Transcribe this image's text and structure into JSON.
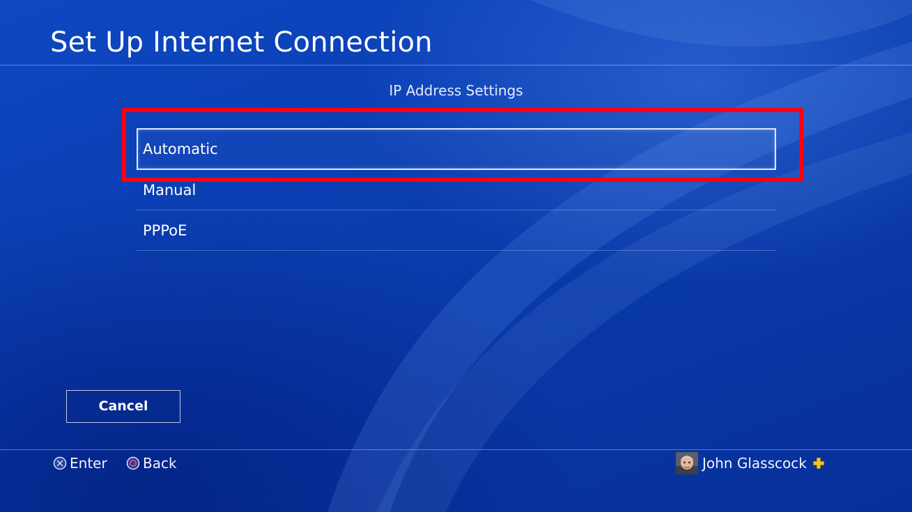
{
  "header": {
    "title": "Set Up Internet Connection"
  },
  "dialog": {
    "subtitle": "IP Address Settings",
    "options": [
      {
        "label": "Automatic",
        "selected": true
      },
      {
        "label": "Manual",
        "selected": false
      },
      {
        "label": "PPPoE",
        "selected": false
      }
    ],
    "cancel_label": "Cancel"
  },
  "footer": {
    "hints": [
      {
        "icon": "cross-button-icon",
        "label": "Enter"
      },
      {
        "icon": "circle-button-icon",
        "label": "Back"
      }
    ],
    "user": {
      "name": "John Glasscock",
      "avatar_icon": "avatar",
      "membership_icon": "playstation-plus-icon"
    }
  },
  "colors": {
    "background": "#0a3fb0",
    "highlight": "#ff0010",
    "plus": "#f7c51b"
  }
}
